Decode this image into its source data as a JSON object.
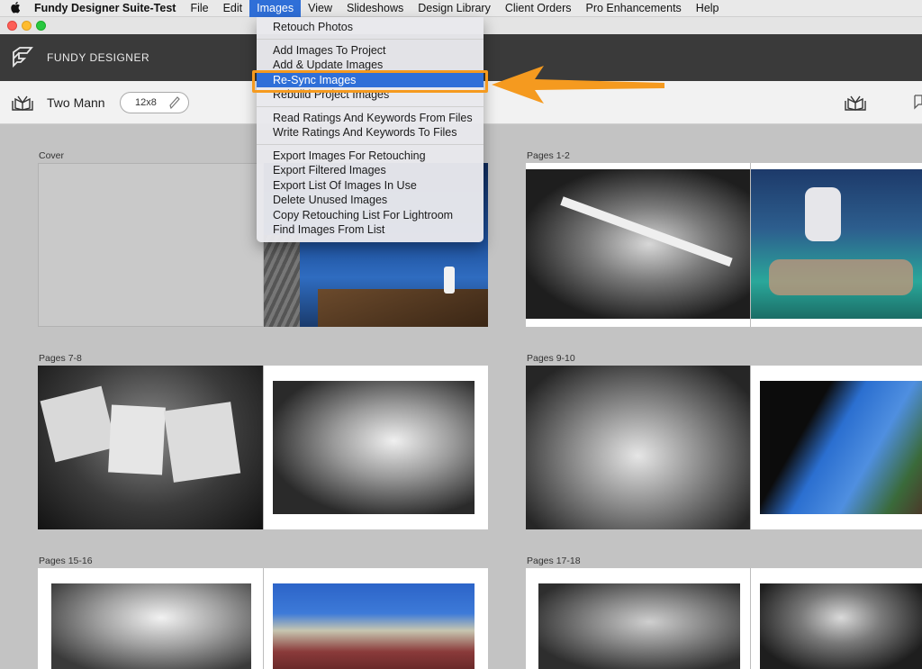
{
  "menubar": {
    "app_name": "Fundy Designer Suite-Test",
    "items": [
      "File",
      "Edit",
      "Images",
      "View",
      "Slideshows",
      "Design Library",
      "Client Orders",
      "Pro Enhancements",
      "Help"
    ],
    "active": "Images"
  },
  "header": {
    "title": "FUNDY DESIGNER"
  },
  "toolbar": {
    "project_name": "Two Mann",
    "size": "12x8"
  },
  "images_menu": {
    "groups": [
      [
        "Retouch Photos"
      ],
      [
        "Add Images To Project",
        "Add & Update Images",
        "Re-Sync Images",
        "Rebuild Project Images"
      ],
      [
        "Read Ratings And Keywords From Files",
        "Write Ratings And Keywords To Files"
      ],
      [
        "Export Images For Retouching",
        "Export Filtered Images",
        "Export List Of Images In Use",
        "Delete Unused Images",
        "Copy Retouching List For Lightroom",
        "Find Images From List"
      ]
    ],
    "highlighted": "Re-Sync Images",
    "highlight_color": "#2f6fd8",
    "annotation_color": "#f59a1f"
  },
  "spreads": [
    {
      "label": "Cover"
    },
    {
      "label": "Pages 1-2"
    },
    {
      "label": "Pages 7-8"
    },
    {
      "label": "Pages 9-10"
    },
    {
      "label": "Pages 15-16"
    },
    {
      "label": "Pages 17-18"
    }
  ]
}
